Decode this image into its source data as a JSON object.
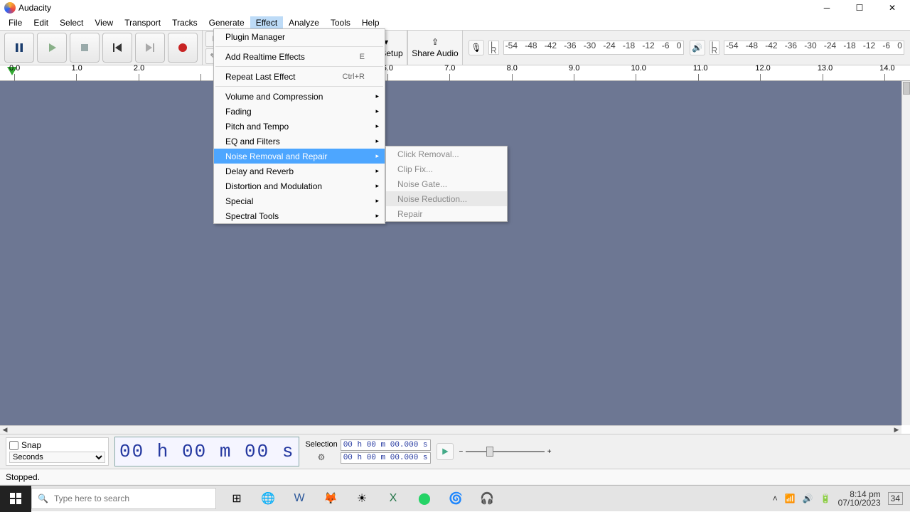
{
  "title": "Audacity",
  "menubar": [
    "File",
    "Edit",
    "Select",
    "View",
    "Transport",
    "Tracks",
    "Generate",
    "Effect",
    "Analyze",
    "Tools",
    "Help"
  ],
  "menubar_open_index": 7,
  "toolbar": {
    "audio_setup": "Audio Setup",
    "share_audio": "Share Audio"
  },
  "meter_ticks": [
    "-54",
    "-48",
    "-42",
    "-36",
    "-30",
    "-24",
    "-18",
    "-12",
    "-6",
    "0"
  ],
  "timeline_ticks": [
    "0.0",
    "1.0",
    "2.0",
    "",
    "",
    "",
    "6.0",
    "7.0",
    "8.0",
    "9.0",
    "10.0",
    "11.0",
    "12.0",
    "13.0",
    "14.0"
  ],
  "effect_menu": [
    {
      "label": "Plugin Manager"
    },
    {
      "sep": true
    },
    {
      "label": "Add Realtime Effects",
      "shortcut": "E"
    },
    {
      "sep": true
    },
    {
      "label": "Repeat Last Effect",
      "shortcut": "Ctrl+R"
    },
    {
      "sep": true
    },
    {
      "label": "Volume and Compression",
      "sub": true
    },
    {
      "label": "Fading",
      "sub": true
    },
    {
      "label": "Pitch and Tempo",
      "sub": true
    },
    {
      "label": "EQ and Filters",
      "sub": true
    },
    {
      "label": "Noise Removal and Repair",
      "sub": true,
      "highlight": true
    },
    {
      "label": "Delay and Reverb",
      "sub": true
    },
    {
      "label": "Distortion and Modulation",
      "sub": true
    },
    {
      "label": "Special",
      "sub": true
    },
    {
      "label": "Spectral Tools",
      "sub": true
    }
  ],
  "noise_submenu": [
    {
      "label": "Click Removal...",
      "disabled": true
    },
    {
      "label": "Clip Fix...",
      "disabled": true
    },
    {
      "label": "Noise Gate...",
      "disabled": true
    },
    {
      "label": "Noise Reduction...",
      "disabled": true,
      "hover": true
    },
    {
      "label": "Repair",
      "disabled": true
    }
  ],
  "snap": {
    "label": "Snap",
    "unit": "Seconds"
  },
  "bigtime": "00 h 00 m 00 s",
  "selection": {
    "label": "Selection",
    "from": "00 h 00 m 00.000 s",
    "to": "00 h 00 m 00.000 s"
  },
  "status": "Stopped.",
  "search_placeholder": "Type here to search",
  "clock": {
    "time": "8:14 pm",
    "date": "07/10/2023"
  },
  "tray_badge": "34"
}
